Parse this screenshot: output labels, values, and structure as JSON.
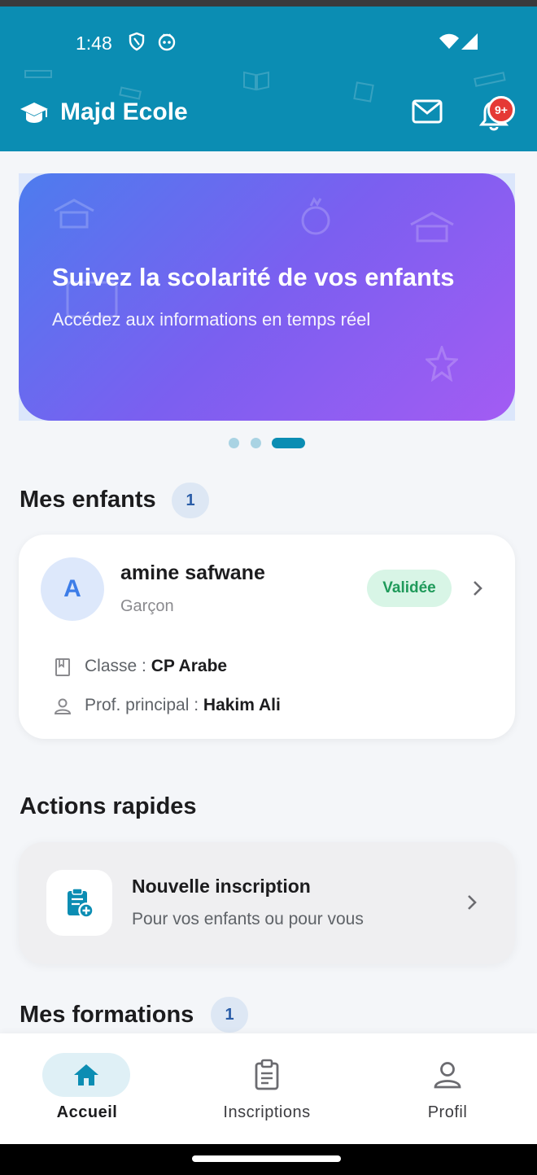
{
  "status_bar": {
    "time": "1:48"
  },
  "header": {
    "app_title": "Majd Ecole",
    "notification_count": "9+"
  },
  "banner": {
    "title": "Suivez la scolarité de vos enfants",
    "subtitle": "Accédez aux informations en temps réel",
    "slides_count": 3,
    "active_slide": 3
  },
  "children_section": {
    "title": "Mes enfants",
    "count": "1",
    "children": [
      {
        "initial": "A",
        "name": "amine safwane",
        "gender": "Garçon",
        "status": "Validée",
        "class_label": "Classe : ",
        "class_value": "CP Arabe",
        "teacher_label": "Prof. principal : ",
        "teacher_value": "Hakim Ali"
      }
    ]
  },
  "quick_actions": {
    "title": "Actions rapides",
    "items": [
      {
        "title": "Nouvelle inscription",
        "subtitle": "Pour vos enfants ou pour vous"
      }
    ]
  },
  "formations_section": {
    "title": "Mes formations",
    "count": "1"
  },
  "bottom_nav": {
    "items": [
      {
        "label": "Accueil",
        "icon": "home-icon",
        "active": true
      },
      {
        "label": "Inscriptions",
        "icon": "clipboard-icon",
        "active": false
      },
      {
        "label": "Profil",
        "icon": "person-icon",
        "active": false
      }
    ]
  },
  "colors": {
    "header": "#0b8db3",
    "accent": "#0b8db3",
    "banner_start": "#4d7cee",
    "banner_end": "#a35cf3",
    "status_valid_bg": "#d8f5e6",
    "status_valid_text": "#1f9a5a",
    "badge_red": "#e53935"
  }
}
